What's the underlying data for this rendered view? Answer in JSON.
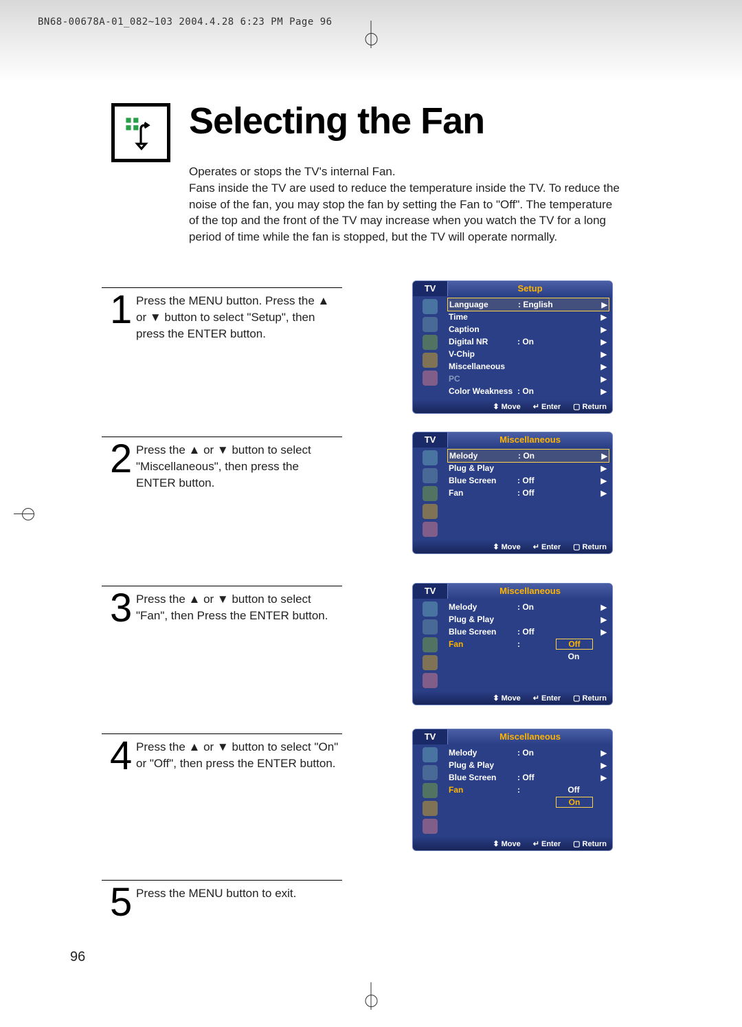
{
  "print_info": "BN68-00678A-01_082~103  2004.4.28  6:23 PM  Page 96",
  "title": "Selecting the Fan",
  "intro": "Operates or stops the TV's internal Fan.\nFans inside the TV are used to reduce the temperature inside the TV. To reduce the noise of the fan, you may stop the fan by setting the Fan to \"Off\". The temperature of the top and the front of the TV may increase when you watch the TV for a long period of time while the fan is stopped, but the TV will operate normally.",
  "steps": {
    "s1": "Press the MENU button. Press the ▲ or ▼ button to select \"Setup\", then press the ENTER button.",
    "s2": "Press the ▲ or ▼ button to select \"Miscellaneous\", then press the ENTER button.",
    "s3": "Press the ▲ or ▼ button to select \"Fan\", then Press the ENTER button.",
    "s4": "Press the ▲ or ▼ button to select \"On\" or \"Off\", then press the ENTER button.",
    "s5": "Press the MENU button to exit."
  },
  "nums": {
    "n1": "1",
    "n2": "2",
    "n3": "3",
    "n4": "4",
    "n5": "5"
  },
  "tv_label": "TV",
  "menu1": {
    "title": "Setup",
    "rows": [
      {
        "label": "Language",
        "val": ": English",
        "hl": true
      },
      {
        "label": "Time",
        "val": ""
      },
      {
        "label": "Caption",
        "val": ""
      },
      {
        "label": "Digital NR",
        "val": ": On"
      },
      {
        "label": "V-Chip",
        "val": ""
      },
      {
        "label": "Miscellaneous",
        "val": ""
      },
      {
        "label": "PC",
        "val": "",
        "grey": true
      },
      {
        "label": "Color Weakness",
        "val": ": On"
      }
    ]
  },
  "menu2": {
    "title": "Miscellaneous",
    "rows": [
      {
        "label": "Melody",
        "val": ": On",
        "hl": true
      },
      {
        "label": "Plug & Play",
        "val": ""
      },
      {
        "label": "Blue Screen",
        "val": ": Off"
      },
      {
        "label": "Fan",
        "val": ": Off"
      }
    ]
  },
  "menu3": {
    "title": "Miscellaneous",
    "rows": [
      {
        "label": "Melody",
        "val": ": On"
      },
      {
        "label": "Plug & Play",
        "val": ""
      },
      {
        "label": "Blue Screen",
        "val": ": Off"
      },
      {
        "label": "Fan",
        "val": ":",
        "yellow": true,
        "opts": [
          "Off",
          "On"
        ],
        "sel": 0
      }
    ]
  },
  "menu4": {
    "title": "Miscellaneous",
    "rows": [
      {
        "label": "Melody",
        "val": ": On"
      },
      {
        "label": "Plug & Play",
        "val": ""
      },
      {
        "label": "Blue Screen",
        "val": ": Off"
      },
      {
        "label": "Fan",
        "val": ":",
        "yellow": true,
        "opts": [
          "Off",
          "On"
        ],
        "sel": 1
      }
    ]
  },
  "foot": {
    "move": "Move",
    "enter": "Enter",
    "return": "Return"
  },
  "page_num": "96"
}
